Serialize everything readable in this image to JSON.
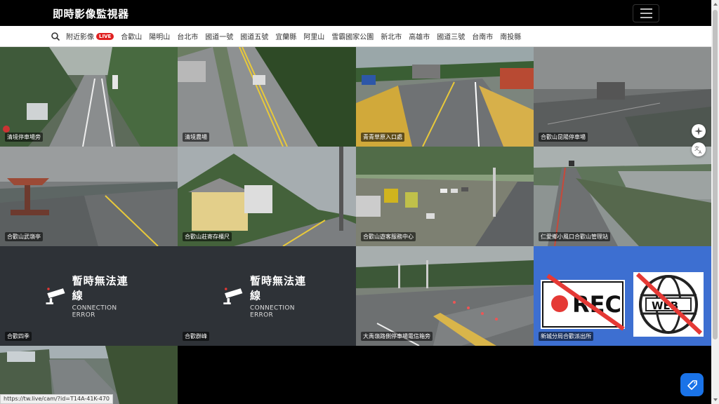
{
  "app": {
    "title": "即時影像監視器"
  },
  "nav": {
    "items": [
      {
        "label": "附近影像",
        "live_badge": "LIVE"
      },
      {
        "label": "合歡山"
      },
      {
        "label": "陽明山"
      },
      {
        "label": "台北市"
      },
      {
        "label": "國道一號"
      },
      {
        "label": "國道五號"
      },
      {
        "label": "宜蘭縣"
      },
      {
        "label": "阿里山"
      },
      {
        "label": "雪霸國家公園"
      },
      {
        "label": "新北市"
      },
      {
        "label": "高雄市"
      },
      {
        "label": "國道三號"
      },
      {
        "label": "台南市"
      },
      {
        "label": "南投縣"
      }
    ]
  },
  "cameras": [
    {
      "caption": "清境停車場旁",
      "scene": "forest-road"
    },
    {
      "caption": "清境農場",
      "scene": "mountain-road"
    },
    {
      "caption": "青青草原入口處",
      "scene": "gate"
    },
    {
      "caption": "合歡山昆陽停車場",
      "scene": "fog"
    },
    {
      "caption": "合歡山武嶺亭",
      "scene": "pavilion"
    },
    {
      "caption": "合歡山莊寄存櫃尺",
      "scene": "lodge"
    },
    {
      "caption": "合歡山遊客服務中心",
      "scene": "parking"
    },
    {
      "caption": "仁愛鄉小風口合歡山管理站",
      "scene": "highland-road"
    },
    {
      "caption": "合歡四季",
      "scene": "error",
      "error_title": "暫時無法連線",
      "error_sub": "CONNECTION ERROR"
    },
    {
      "caption": "合歡群峰",
      "scene": "error",
      "error_title": "暫時無法連線",
      "error_sub": "CONNECTION ERROR"
    },
    {
      "caption": "大禹嶺路側停車場電信箱旁",
      "scene": "junction"
    },
    {
      "caption": "新城分局合歡派出所",
      "scene": "police",
      "rec_text": "REC",
      "web_text": "WEB"
    },
    {
      "caption": "",
      "scene": "rain-road"
    }
  ],
  "status_url": "https://tw.live/cam/?id=T14A-41K-470",
  "icons": {
    "search": "search-icon",
    "menu": "menu-icon",
    "ai": "sparkle-icon",
    "translate": "translate-icon",
    "tag": "tag-icon"
  }
}
